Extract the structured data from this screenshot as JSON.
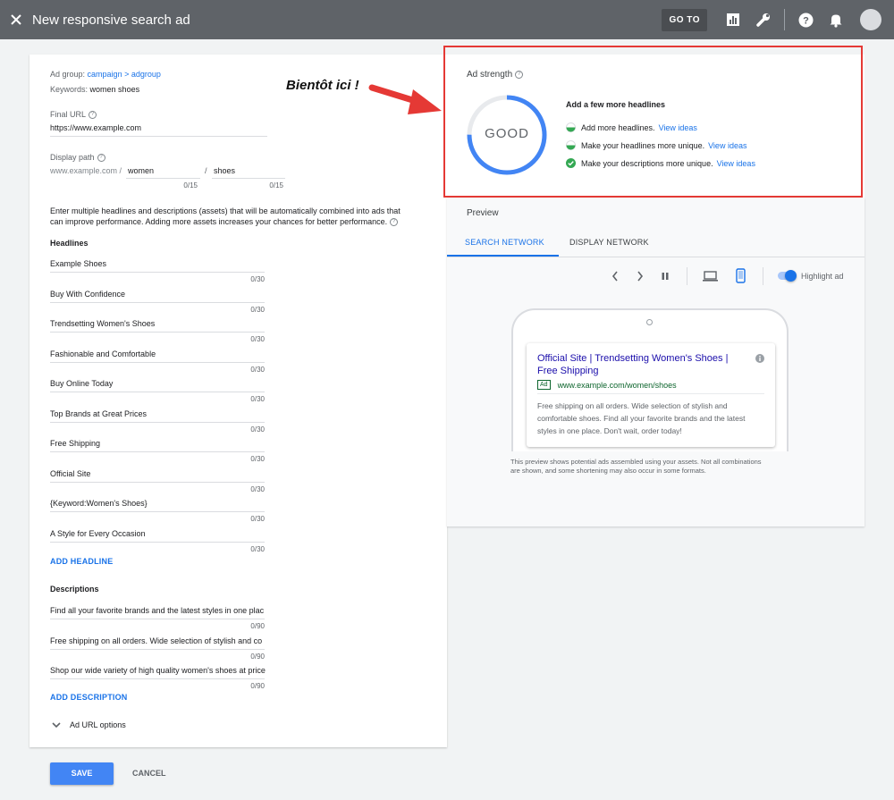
{
  "topbar": {
    "title": "New responsive search ad",
    "goto_label": "GO TO",
    "icons": [
      "close-icon",
      "reports-icon",
      "tools-wrench-icon",
      "help-icon",
      "bell-icon",
      "avatar"
    ]
  },
  "form": {
    "ad_group_label": "Ad group:",
    "ad_group_value": "campaign > adgroup",
    "keywords_label": "Keywords:",
    "keywords_value": "women shoes",
    "final_url_label": "Final URL",
    "final_url_value": "https://www.example.com",
    "display_path_label": "Display path",
    "display_path_prefix": "www.example.com /",
    "path1_value": "women",
    "path_sep": "/",
    "path2_value": "shoes",
    "path1_count": "0/15",
    "path2_count": "0/15",
    "intro_text_1": "Enter multiple headlines and descriptions (assets)  that will be automatically combined into ads that",
    "intro_text_2": "can improve performance. Adding more assets increases your chances for better performance.",
    "headlines_title": "Headlines",
    "headlines": [
      {
        "text": "Example Shoes",
        "count": "0/30"
      },
      {
        "text": "Buy With Confidence",
        "count": "0/30"
      },
      {
        "text": "Trendsetting Women's Shoes",
        "count": "0/30"
      },
      {
        "text": "Fashionable and Comfortable",
        "count": "0/30"
      },
      {
        "text": "Buy Online Today",
        "count": "0/30"
      },
      {
        "text": "Top Brands at Great Prices",
        "count": "0/30"
      },
      {
        "text": "Free Shipping",
        "count": "0/30"
      },
      {
        "text": "Official Site",
        "count": "0/30"
      },
      {
        "text": "{Keyword:Women's Shoes}",
        "count": "0/30"
      },
      {
        "text": "A Style for Every Occasion",
        "count": "0/30"
      }
    ],
    "add_headline_label": "ADD HEADLINE",
    "descriptions_title": "Descriptions",
    "descriptions": [
      {
        "text": "Find all your favorite brands and the latest styles in one plac",
        "count": "0/90"
      },
      {
        "text": "Free shipping on all orders. Wide selection of stylish and co",
        "count": "0/90"
      },
      {
        "text": "Shop our wide variety of high quality women's shoes at price",
        "count": "0/90"
      }
    ],
    "add_description_label": "ADD DESCRIPTION",
    "url_options_label": "Ad URL options"
  },
  "strength": {
    "title": "Ad strength",
    "rating": "GOOD",
    "ring_fraction": 0.75,
    "ring_color": "#4285f4",
    "headline": "Add a few more headlines",
    "tips": [
      {
        "text": "Add more headlines.",
        "link": "View ideas",
        "status": "half"
      },
      {
        "text": "Make your headlines more unique.",
        "link": "View ideas",
        "status": "half"
      },
      {
        "text": "Make your descriptions more unique.",
        "link": "View ideas",
        "status": "done"
      }
    ]
  },
  "annotation": "Bientôt ici !",
  "preview": {
    "title": "Preview",
    "tabs": [
      "SEARCH NETWORK",
      "DISPLAY NETWORK"
    ],
    "active_tab": 0,
    "highlight_label": "Highlight ad",
    "ad_headline_1": "Official Site | Trendsetting Women's Shoes |",
    "ad_headline_2": "Free Shipping",
    "ad_badge": "Ad",
    "ad_url": "www.example.com/women/shoes",
    "ad_desc_1": "Free shipping on all orders. Wide selection of stylish and",
    "ad_desc_2": "comfortable shoes. Find all your favorite brands and the latest",
    "ad_desc_3": "styles in one place. Don't wait, order today!",
    "note_1": "This preview shows potential ads assembled using your assets. Not all combinations",
    "note_2": "are shown, and some shortening may also occur in some formats."
  },
  "actions": {
    "save_label": "SAVE",
    "cancel_label": "CANCEL"
  }
}
